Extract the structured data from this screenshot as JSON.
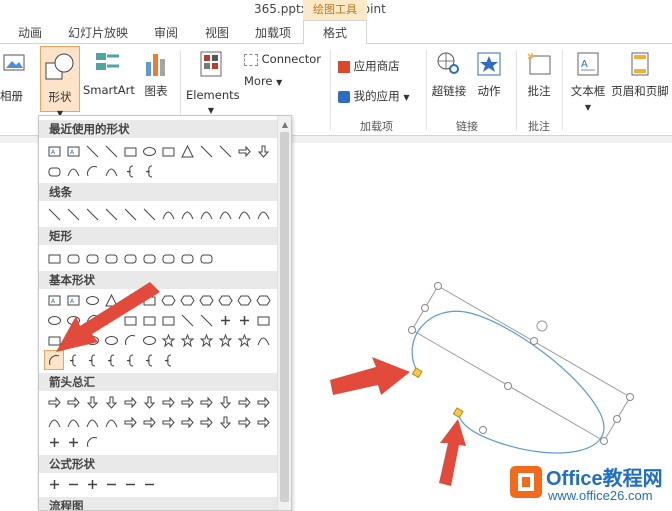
{
  "window": {
    "title": "365.pptx - PowerPoint",
    "context_group": "绘图工具"
  },
  "tabs": [
    {
      "label": "动画"
    },
    {
      "label": "幻灯片放映"
    },
    {
      "label": "审阅"
    },
    {
      "label": "视图"
    },
    {
      "label": "加载项"
    },
    {
      "label": "格式"
    }
  ],
  "ribbon": {
    "album_label": "相册",
    "shapes_label": "形状",
    "smartart_label": "SmartArt",
    "chart_label": "图表",
    "elements_label": "Elements",
    "connector_label": "Connector",
    "more_label": "More",
    "store_label": "应用商店",
    "myapps_label": "我的应用",
    "addins_group": "加载项",
    "hyperlink_label": "超链接",
    "action_label": "动作",
    "links_group": "链接",
    "comment_label": "批注",
    "comments_group": "批注",
    "textbox_label": "文本框",
    "header_footer_label": "页眉和页脚"
  },
  "shapes_menu": {
    "recent": "最近使用的形状",
    "lines": "线条",
    "rectangles": "矩形",
    "basic": "基本形状",
    "arrows": "箭头总汇",
    "equation": "公式形状",
    "flowchart": "流程图"
  },
  "watermark": {
    "title": "Office教程网",
    "url": "www.office26.com"
  },
  "colors": {
    "accent_orange": "#f0a35c",
    "context_tab": "#fde9c7",
    "arrow_red": "#e24a3b",
    "ellipse_blue": "#5b9bd5",
    "handle_yellow": "#f2c94c",
    "watermark_orange": "#f26b1d",
    "watermark_blue": "#1f6fc5"
  }
}
